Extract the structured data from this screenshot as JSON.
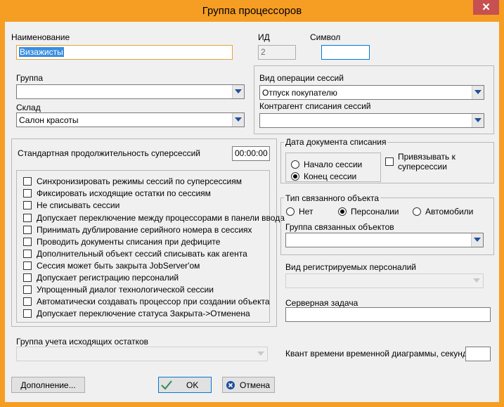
{
  "window": {
    "title": "Группа процессоров",
    "close_glyph": "✕"
  },
  "name": {
    "label": "Наименование",
    "value": "Визажисты"
  },
  "id": {
    "label": "ИД",
    "value": "2"
  },
  "symbol": {
    "label": "Символ",
    "value": ""
  },
  "group": {
    "label": "Группа",
    "value": ""
  },
  "warehouse": {
    "label": "Склад",
    "value": "Салон красоты"
  },
  "session_op": {
    "label": "Вид операции сессий",
    "value": "Отпуск покупателю"
  },
  "counterparty": {
    "label": "Контрагент списания сессий",
    "value": ""
  },
  "std_duration": {
    "label": "Стандартная продолжительность суперсессий",
    "value": "00:00:00"
  },
  "options": [
    {
      "label": "Синхронизировать режимы сессий по суперсессиям",
      "checked": false
    },
    {
      "label": "Фиксировать исходящие остатки по сессиям",
      "checked": false
    },
    {
      "label": "Не списывать сессии",
      "checked": false
    },
    {
      "label": "Допускает переключение между процессорами в панели ввода",
      "checked": false
    },
    {
      "label": "Принимать дублирование серийного номера в сессиях",
      "checked": false
    },
    {
      "label": "Проводить документы списания при дефиците",
      "checked": false
    },
    {
      "label": "Дополнительный объект сессий списывать как агента",
      "checked": false
    },
    {
      "label": "Сессия может быть закрыта JobServer'ом",
      "checked": false
    },
    {
      "label": "Допускает регистрацию персоналий",
      "checked": false
    },
    {
      "label": "Упрощенный диалог технологической сессии",
      "checked": false
    },
    {
      "label": "Автоматически создавать процессор при создании объекта",
      "checked": false
    },
    {
      "label": "Допускает переключение статуса Закрыта->Отменена",
      "checked": false
    }
  ],
  "writeoff_date": {
    "title": "Дата документа списания",
    "start_label": "Начало сессии",
    "end_label": "Конец сессии",
    "selected": "end"
  },
  "bind_super": {
    "label": "Привязывать к суперсессии",
    "checked": false
  },
  "linked_type": {
    "title": "Тип связанного объекта",
    "options": [
      "Нет",
      "Персоналии",
      "Автомобили"
    ],
    "selected": "Персоналии",
    "group_label": "Группа связанных объектов",
    "group_value": ""
  },
  "reg_persons": {
    "label": "Вид регистрируемых персоналий",
    "value": ""
  },
  "server_task": {
    "label": "Серверная задача",
    "value": ""
  },
  "quantum": {
    "label": "Квант времени временной диаграммы, секунд",
    "value": ""
  },
  "outgoing_group": {
    "label": "Группа учета исходящих остатков",
    "value": ""
  },
  "buttons": {
    "more": "Дополнение...",
    "ok": "OK",
    "cancel": "Отмена"
  },
  "colors": {
    "frame": "#f69d24",
    "accent": "#0078d7",
    "close": "#c75050",
    "ok_check": "#2e8b57",
    "cancel_x": "#1f4e9e"
  }
}
